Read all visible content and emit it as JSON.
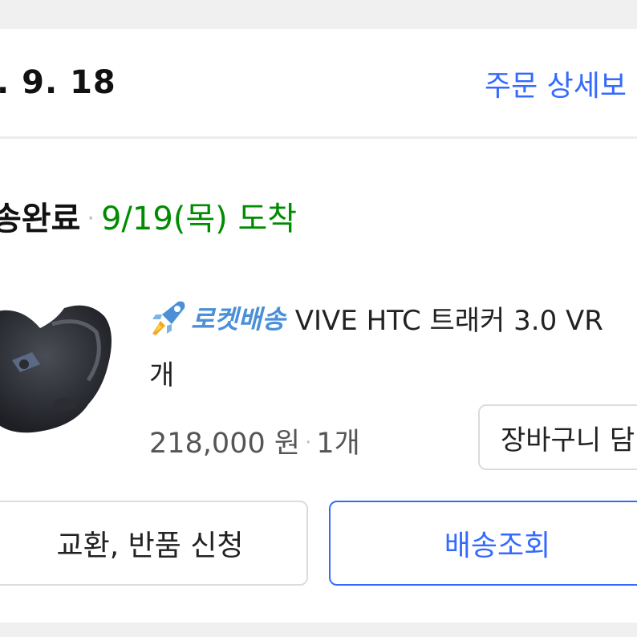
{
  "header": {
    "order_date": ". 9. 18",
    "detail_link": "주문 상세보"
  },
  "status": {
    "label": "송완료",
    "separator": "·",
    "arrival": "9/19(목) 도착"
  },
  "product": {
    "badge_label": "로켓배송",
    "badge_icon": "rocket-icon",
    "name": "VIVE HTC 트래커 3.0 VR",
    "name_cont": "개",
    "price": "218,000 원",
    "separator": "·",
    "quantity": "1개"
  },
  "buttons": {
    "cart": "장바구니 담",
    "exchange": "교환, 반품 신청",
    "track": "배송조회"
  },
  "colors": {
    "accent": "#346aff",
    "arrival_green": "#008c00",
    "rocket_blue": "#4a8fd8"
  }
}
